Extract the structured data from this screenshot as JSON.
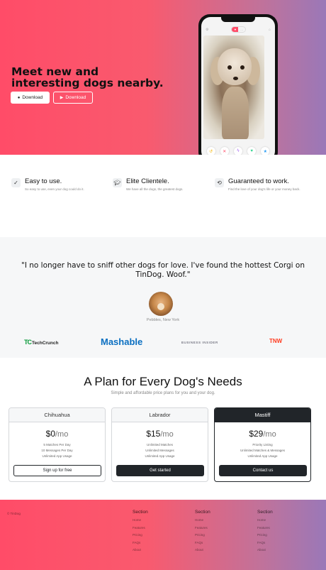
{
  "hero": {
    "title": "Meet new and interesting dogs nearby.",
    "download_apple": "Download",
    "download_play": "Download",
    "phone": {
      "toggle_left": "●",
      "toggle_right": "..."
    }
  },
  "features": [
    {
      "title": "Easy to use.",
      "text": "So easy to use, even your dog could do it."
    },
    {
      "title": "Elite Clientele.",
      "text": "We have all the dogs, the greatest dogs."
    },
    {
      "title": "Guaranteed to work.",
      "text": "Find the love of your dog's life or your money back."
    }
  ],
  "testimonial": {
    "quote": "\"I no longer have to sniff other dogs for love. I've found the hottest Corgi on TinDog. Woof.\"",
    "place": "Pebbles, New York"
  },
  "press": {
    "techcrunch_mark": "TC",
    "techcrunch_text": "TechCrunch",
    "mashable": "Mashable",
    "business_insider": "BUSINESS INSIDER",
    "tnw": "TNW"
  },
  "pricing": {
    "title": "A Plan for Every Dog's Needs",
    "subtitle": "Simple and affordable price plans for you and your dog.",
    "plans": [
      {
        "name": "Chihuahua",
        "price": "$0",
        "unit": "/mo",
        "features": [
          "5 Matches Per Day",
          "10 Messages Per Day",
          "Unlimited App Usage"
        ],
        "cta": "Sign up for free"
      },
      {
        "name": "Labrador",
        "price": "$15",
        "unit": "/mo",
        "features": [
          "Unlimited Matches",
          "Unlimited Messages",
          "Unlimited App Usage"
        ],
        "cta": "Get started"
      },
      {
        "name": "Mastiff",
        "price": "$29",
        "unit": "/mo",
        "features": [
          "Priority Listing",
          "Unlimited Matches & Messages",
          "Unlimited App Usage"
        ],
        "cta": "Contact us"
      }
    ]
  },
  "footer": {
    "copyright": "© TinDog",
    "columns": [
      {
        "title": "Section",
        "links": [
          "Home",
          "Features",
          "Pricing",
          "FAQs",
          "About"
        ]
      },
      {
        "title": "Section",
        "links": [
          "Home",
          "Features",
          "Pricing",
          "FAQs",
          "About"
        ]
      },
      {
        "title": "Section",
        "links": [
          "Home",
          "Features",
          "Pricing",
          "FAQs",
          "About"
        ]
      }
    ]
  },
  "colors": {
    "brand_pink": "#ff4c68",
    "brand_purple": "#9a78b8",
    "dark": "#212529"
  }
}
